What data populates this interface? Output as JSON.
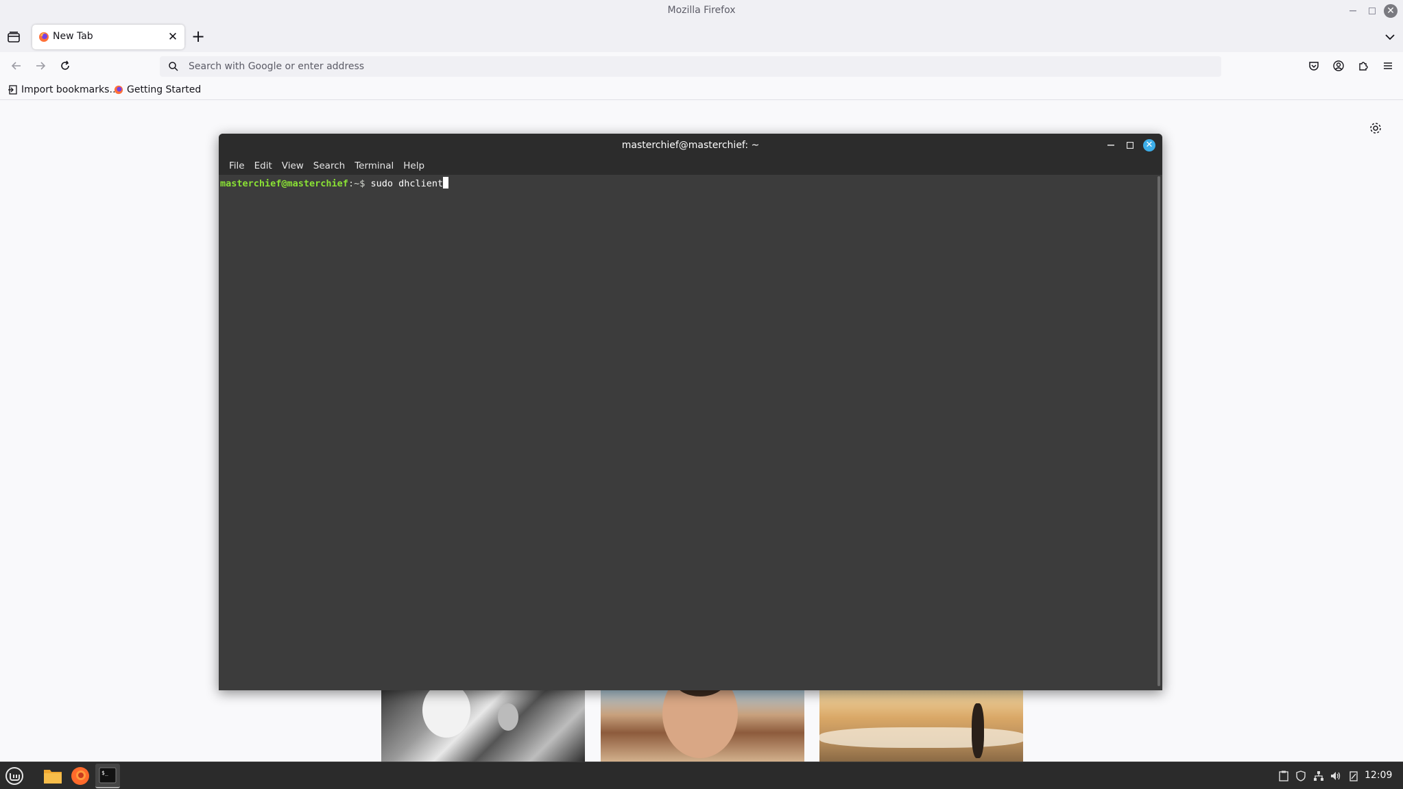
{
  "browser": {
    "window_title": "Mozilla Firefox",
    "tab": {
      "title": "New Tab",
      "close_glyph": "✕"
    },
    "new_tab_glyph": "+",
    "urlbar": {
      "placeholder": "Search with Google or enter address",
      "value": ""
    },
    "bookmarks": [
      {
        "label": "Import bookmarks…",
        "icon": "import-icon"
      },
      {
        "label": "Getting Started",
        "icon": "firefox-icon"
      }
    ],
    "colors": {
      "chrome": "#f0f0f4",
      "page": "#f9f9fb"
    }
  },
  "terminal": {
    "title": "masterchief@masterchief: ~",
    "menu": [
      "File",
      "Edit",
      "View",
      "Search",
      "Terminal",
      "Help"
    ],
    "prompt_user": "masterchief@masterchief",
    "prompt_path": ":~$",
    "command": " sudo dhclient",
    "colors": {
      "prompt_user": "#8ae234",
      "background": "#3c3c3c",
      "close_button": "#3daee9"
    }
  },
  "taskbar": {
    "clock": "12:09",
    "apps": [
      "mint-menu-icon",
      "files-icon",
      "firefox-icon",
      "terminal-icon"
    ]
  }
}
